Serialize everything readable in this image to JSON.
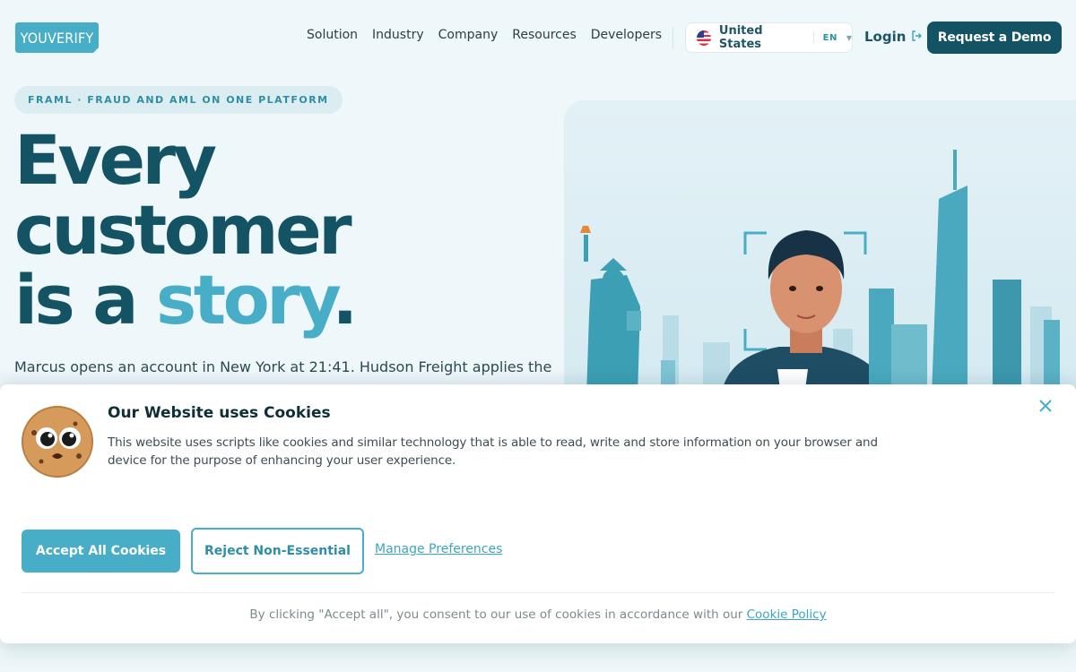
{
  "header": {
    "logo_text": "YOUVERIFY",
    "nav": [
      "Solution",
      "Industry",
      "Company",
      "Resources",
      "Developers"
    ],
    "locale": {
      "country": "United States",
      "language": "EN"
    },
    "login_label": "Login",
    "demo_label": "Request a Demo"
  },
  "hero": {
    "eyebrow": "FRAML · FRAUD AND AML ON ONE PLATFORM",
    "headline_line1": "Every",
    "headline_line2": "customer",
    "headline_line3_prefix": "is a ",
    "headline_accent": "story",
    "headline_period": ".",
    "lede": "Marcus opens an account in New York at 21:41. Hudson Freight applies the"
  },
  "cookie_banner": {
    "title": "Our Website uses Cookies",
    "body": "This website uses scripts like cookies and similar technology that is able to read, write and store information on your browser and device for the purpose of enhancing your user experience.",
    "accept_label": "Accept All Cookies",
    "reject_label": "Reject Non-Essential",
    "manage_label": "Manage Preferences",
    "footer_text": "By clicking \"Accept all\", you consent to our use of cookies in accordance with our ",
    "policy_link": "Cookie Policy"
  },
  "colors": {
    "brand_dark": "#145363",
    "brand_accent": "#48aec7",
    "page_background": "#eef7f9"
  },
  "icons": [
    "flag-us-icon",
    "chevron-down-icon",
    "login-arrow-icon",
    "close-icon",
    "cookie-mascot-icon"
  ]
}
